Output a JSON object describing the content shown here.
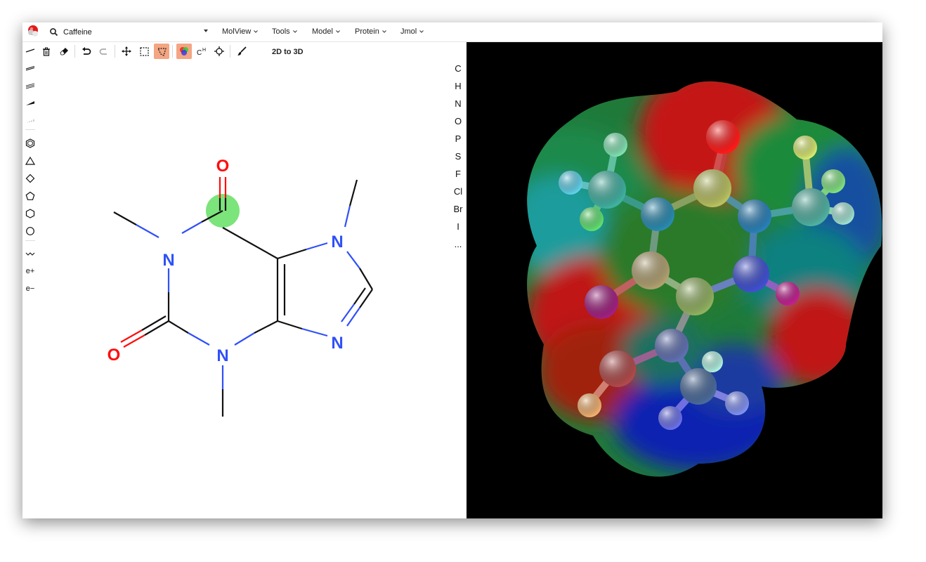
{
  "search": {
    "value": "Caffeine"
  },
  "menus": [
    "MolView",
    "Tools",
    "Model",
    "Protein",
    "Jmol"
  ],
  "toolbar": {
    "convert_label": "2D to 3D",
    "active_color": "#f4a582"
  },
  "elements": [
    "C",
    "H",
    "N",
    "O",
    "P",
    "S",
    "F",
    "Cl",
    "Br",
    "I",
    "..."
  ],
  "left_tools": {
    "charge_plus": "e+",
    "charge_minus": "e−"
  },
  "molecule_2d": {
    "atom_labels": {
      "o_top": "O",
      "o_left": "O",
      "n1": "N",
      "n3": "N",
      "n7": "N",
      "n9": "N"
    },
    "colors": {
      "oxygen": "#ff0d0d",
      "nitrogen": "#3050f8",
      "bond": "#111111",
      "highlight": "#7be47b"
    }
  },
  "viewer_3d": {
    "background": "#000000",
    "surface": "electrostatic potential"
  }
}
